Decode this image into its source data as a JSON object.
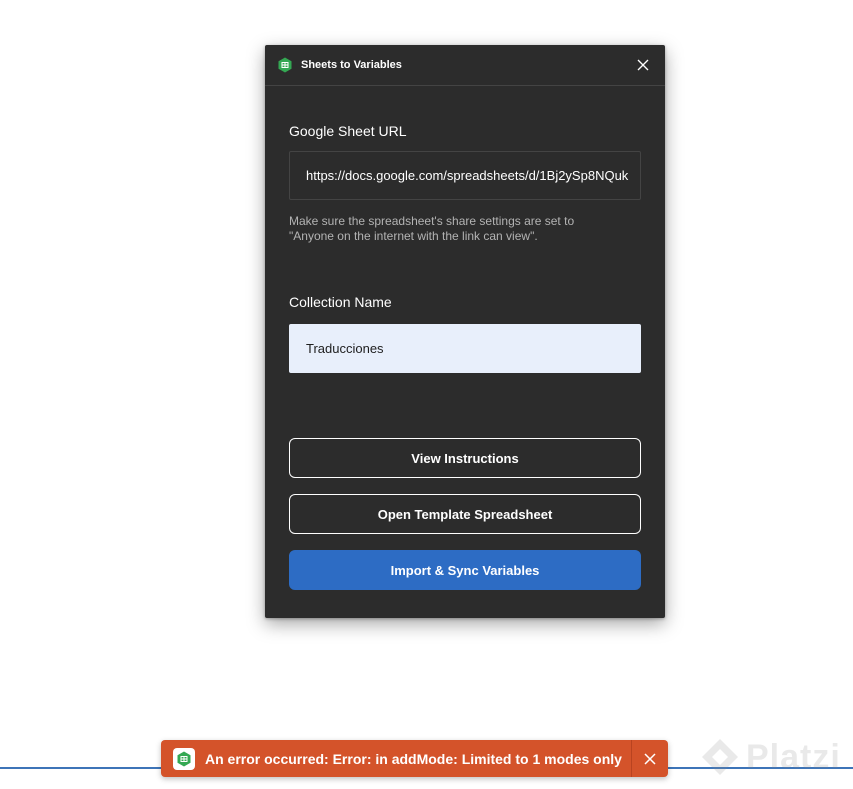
{
  "plugin": {
    "title": "Sheets to Variables",
    "icon": "sheets-icon",
    "close_icon": "close-icon",
    "accent_color": "#2d6cc4"
  },
  "form": {
    "url_label": "Google Sheet URL",
    "url_value": "https://docs.google.com/spreadsheets/d/1Bj2ySp8NQuk",
    "helper_line1": "Make sure the spreadsheet's share settings are set to",
    "helper_line2": "\"Anyone on the internet with the link can view\".",
    "collection_label": "Collection Name",
    "collection_value": "Traducciones"
  },
  "buttons": {
    "view_instructions": "View Instructions",
    "open_template": "Open Template Spreadsheet",
    "import_sync": "Import & Sync Variables"
  },
  "toast": {
    "message": "An error occurred: Error: in addMode: Limited to 1 modes only",
    "color": "#d4532a"
  },
  "watermark": {
    "text": "Platzi"
  }
}
